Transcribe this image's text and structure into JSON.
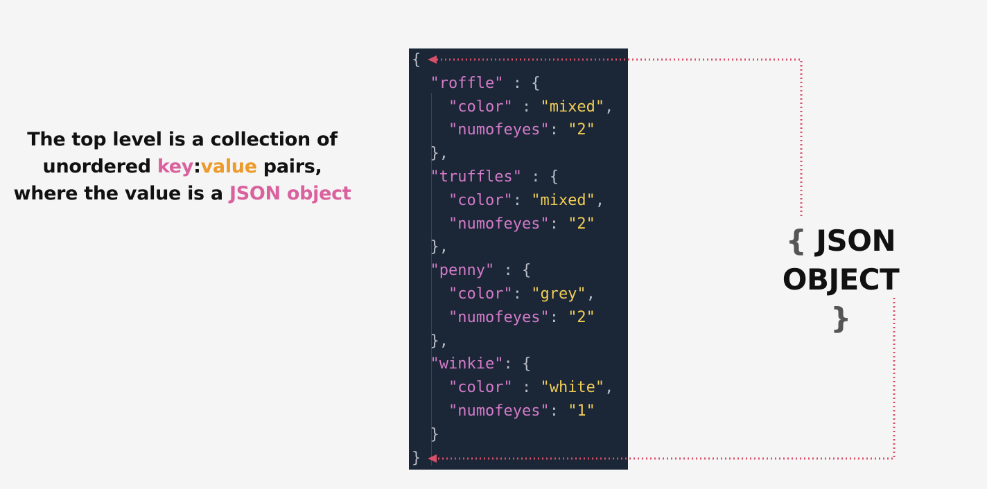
{
  "caption": {
    "line1": "The top level is a collection of",
    "line2_pre": "unordered ",
    "key": "key",
    "colon": ":",
    "value": "value",
    "line2_post": " pairs,",
    "line3_pre": "where the value is a ",
    "json_object": "JSON object"
  },
  "label": {
    "open_brace": "{",
    "word1": "JSON",
    "word2": "OBJECT",
    "close_brace": "}"
  },
  "colors": {
    "key": "#d9619e",
    "value": "#ec9a2b",
    "arrow": "#d9506a",
    "code_bg": "#1b2637"
  },
  "code_lines": [
    [
      {
        "t": "{",
        "c": "p"
      }
    ],
    [
      {
        "t": "  ",
        "c": "p"
      },
      {
        "t": "\"roffle\"",
        "c": "key"
      },
      {
        "t": " : {",
        "c": "p"
      }
    ],
    [
      {
        "t": "    ",
        "c": "p"
      },
      {
        "t": "\"color\"",
        "c": "key"
      },
      {
        "t": " : ",
        "c": "p"
      },
      {
        "t": "\"mixed\"",
        "c": "str"
      },
      {
        "t": ",",
        "c": "p"
      }
    ],
    [
      {
        "t": "    ",
        "c": "p"
      },
      {
        "t": "\"numofeyes\"",
        "c": "key"
      },
      {
        "t": ": ",
        "c": "p"
      },
      {
        "t": "\"2\"",
        "c": "str"
      }
    ],
    [
      {
        "t": "  },",
        "c": "p"
      }
    ],
    [
      {
        "t": "  ",
        "c": "p"
      },
      {
        "t": "\"truffles\"",
        "c": "key"
      },
      {
        "t": " : {",
        "c": "p"
      }
    ],
    [
      {
        "t": "    ",
        "c": "p"
      },
      {
        "t": "\"color\"",
        "c": "key"
      },
      {
        "t": ": ",
        "c": "p"
      },
      {
        "t": "\"mixed\"",
        "c": "str"
      },
      {
        "t": ",",
        "c": "p"
      }
    ],
    [
      {
        "t": "    ",
        "c": "p"
      },
      {
        "t": "\"numofeyes\"",
        "c": "key"
      },
      {
        "t": ": ",
        "c": "p"
      },
      {
        "t": "\"2\"",
        "c": "str"
      }
    ],
    [
      {
        "t": "  },",
        "c": "p"
      }
    ],
    [
      {
        "t": "  ",
        "c": "p"
      },
      {
        "t": "\"penny\"",
        "c": "key"
      },
      {
        "t": " : {",
        "c": "p"
      }
    ],
    [
      {
        "t": "    ",
        "c": "p"
      },
      {
        "t": "\"color\"",
        "c": "key"
      },
      {
        "t": ": ",
        "c": "p"
      },
      {
        "t": "\"grey\"",
        "c": "str"
      },
      {
        "t": ",",
        "c": "p"
      }
    ],
    [
      {
        "t": "    ",
        "c": "p"
      },
      {
        "t": "\"numofeyes\"",
        "c": "key"
      },
      {
        "t": ": ",
        "c": "p"
      },
      {
        "t": "\"2\"",
        "c": "str"
      }
    ],
    [
      {
        "t": "  },",
        "c": "p"
      }
    ],
    [
      {
        "t": "  ",
        "c": "p"
      },
      {
        "t": "\"winkie\"",
        "c": "key"
      },
      {
        "t": ": {",
        "c": "p"
      }
    ],
    [
      {
        "t": "    ",
        "c": "p"
      },
      {
        "t": "\"color\"",
        "c": "key"
      },
      {
        "t": " : ",
        "c": "p"
      },
      {
        "t": "\"white\"",
        "c": "str"
      },
      {
        "t": ",",
        "c": "p"
      }
    ],
    [
      {
        "t": "    ",
        "c": "p"
      },
      {
        "t": "\"numofeyes\"",
        "c": "key"
      },
      {
        "t": ": ",
        "c": "p"
      },
      {
        "t": "\"1\"",
        "c": "str"
      }
    ],
    [
      {
        "t": "  }",
        "c": "p"
      }
    ],
    [
      {
        "t": "}",
        "c": "p"
      }
    ]
  ]
}
